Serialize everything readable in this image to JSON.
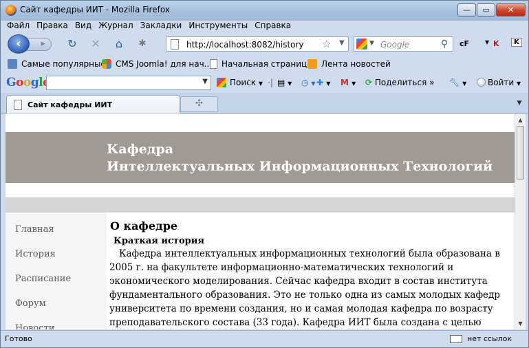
{
  "window": {
    "title": "Сайт кафедры ИИТ - Mozilla Firefox",
    "min_label": "—",
    "max_label": "▭",
    "close_label": "✕"
  },
  "menu": [
    "Файл",
    "Правка",
    "Вид",
    "Журнал",
    "Закладки",
    "Инструменты",
    "Справка"
  ],
  "nav": {
    "url": "http://localhost:8082/history",
    "search_placeholder": "Google"
  },
  "bookmarks": [
    "Самые популярные",
    "CMS Joomla! для нач...",
    "Начальная страница",
    "Лента новостей"
  ],
  "google_toolbar": {
    "logo": [
      "G",
      "o",
      "o",
      "g",
      "l",
      "e"
    ],
    "search_label": "Поиск",
    "share_label": "Поделиться",
    "login_label": "Войти"
  },
  "tab": {
    "title": "Сайт кафедры ИИТ"
  },
  "site": {
    "header_line1": "Кафедра",
    "header_line2": "Интеллектуальных Информационных Технологий",
    "nav_items": [
      "Главная",
      "История",
      "Расписание",
      "Форум",
      "Новости"
    ],
    "heading": "О кафедре",
    "subheading": "Краткая история",
    "paragraph": "Кафедра интеллектуальных информационных технологий была образована в 2005 г. на факультете информационно-математических технологий и экономического моделирования. Сейчас кафедра входит в состав института фундаментального образования. Это не только одна из самых молодых кафедр университета по времени создания, но и самая молодая кафедра по возрасту преподавательского состава (33 года). Кафедра ИИТ была создана с целью повышения качества образования в"
  },
  "status": {
    "text": "Готово",
    "links": "нет ссылок"
  }
}
